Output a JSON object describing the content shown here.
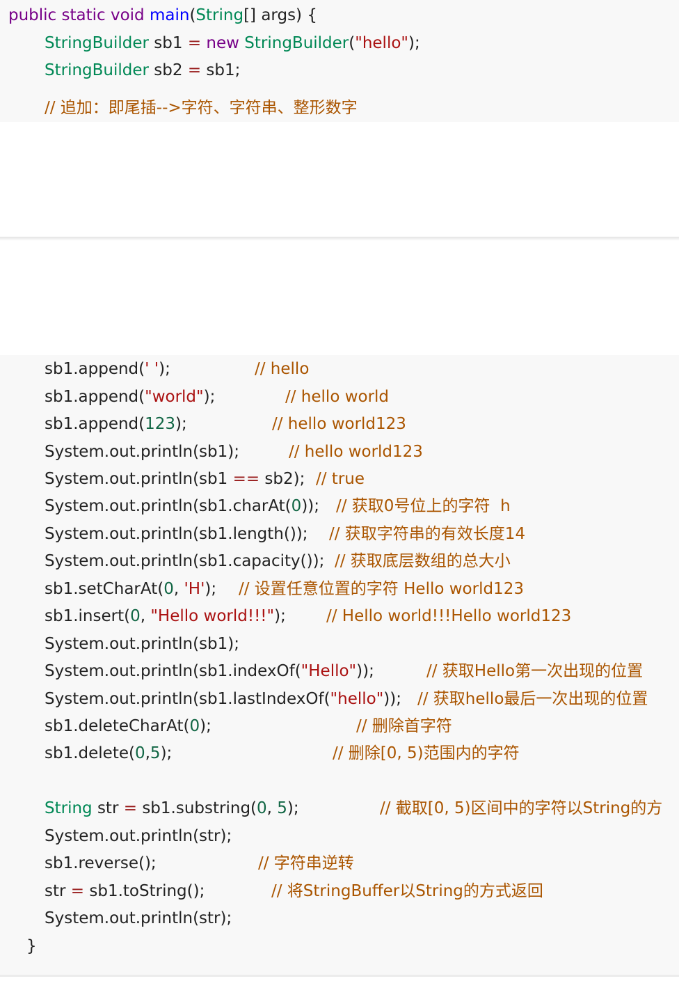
{
  "colors": {
    "keyword": "#770088",
    "type": "#008855",
    "function": "#0000ff",
    "string": "#aa1111",
    "number": "#116644",
    "operator": "#981a1a",
    "comment": "#aa5500",
    "plain": "#222222",
    "code_background": "#f8f8f8"
  },
  "top_block": {
    "lines": [
      [
        {
          "t": "public static void ",
          "k": "kw"
        },
        {
          "t": "main",
          "k": "fn"
        },
        {
          "t": "(",
          "k": "plain"
        },
        {
          "t": "String",
          "k": "type"
        },
        {
          "t": "[] args) {",
          "k": "plain"
        }
      ],
      [
        {
          "t": "StringBuilder",
          "k": "type"
        },
        {
          "t": " sb1 ",
          "k": "plain"
        },
        {
          "t": "=",
          "k": "op"
        },
        {
          "t": " ",
          "k": "plain"
        },
        {
          "t": "new",
          "k": "kw"
        },
        {
          "t": " ",
          "k": "plain"
        },
        {
          "t": "StringBuilder",
          "k": "type"
        },
        {
          "t": "(",
          "k": "plain"
        },
        {
          "t": "\"hello\"",
          "k": "str"
        },
        {
          "t": ");",
          "k": "plain"
        }
      ],
      [
        {
          "t": "StringBuilder",
          "k": "type"
        },
        {
          "t": " sb2 ",
          "k": "plain"
        },
        {
          "t": "=",
          "k": "op"
        },
        {
          "t": " sb1;",
          "k": "plain"
        }
      ],
      [
        {
          "t": "// 追加：即尾插-->字符、字符串、整形数字",
          "k": "cm"
        }
      ]
    ]
  },
  "bottom_block": {
    "lines": [
      {
        "code": [
          {
            "t": "sb1.append(",
            "k": "plain"
          },
          {
            "t": "' '",
            "k": "str"
          },
          {
            "t": ");",
            "k": "plain"
          }
        ],
        "comment": "// hello"
      },
      {
        "code": [
          {
            "t": "sb1.append(",
            "k": "plain"
          },
          {
            "t": "\"world\"",
            "k": "str"
          },
          {
            "t": ");",
            "k": "plain"
          }
        ],
        "comment": "// hello world"
      },
      {
        "code": [
          {
            "t": "sb1.append(",
            "k": "plain"
          },
          {
            "t": "123",
            "k": "num"
          },
          {
            "t": ");",
            "k": "plain"
          }
        ],
        "comment": "// hello world123"
      },
      {
        "code": [
          {
            "t": "System.out.println(sb1);",
            "k": "plain"
          }
        ],
        "comment": "// hello world123"
      },
      {
        "code": [
          {
            "t": "System.out.println(sb1 ",
            "k": "plain"
          },
          {
            "t": "==",
            "k": "op"
          },
          {
            "t": " sb2);",
            "k": "plain"
          }
        ],
        "comment": "// true"
      },
      {
        "code": [
          {
            "t": "System.out.println(sb1.charAt(",
            "k": "plain"
          },
          {
            "t": "0",
            "k": "num"
          },
          {
            "t": "));",
            "k": "plain"
          }
        ],
        "comment": "// 获取0号位上的字符  h"
      },
      {
        "code": [
          {
            "t": "System.out.println(sb1.length());",
            "k": "plain"
          }
        ],
        "comment": "// 获取字符串的有效长度14"
      },
      {
        "code": [
          {
            "t": "System.out.println(sb1.capacity());",
            "k": "plain"
          }
        ],
        "comment": "// 获取底层数组的总大小"
      },
      {
        "code": [
          {
            "t": "sb1.setCharAt(",
            "k": "plain"
          },
          {
            "t": "0",
            "k": "num"
          },
          {
            "t": ", ",
            "k": "plain"
          },
          {
            "t": "'H'",
            "k": "str"
          },
          {
            "t": ");",
            "k": "plain"
          }
        ],
        "comment": "// 设置任意位置的字符 Hello world123"
      },
      {
        "code": [
          {
            "t": "sb1.insert(",
            "k": "plain"
          },
          {
            "t": "0",
            "k": "num"
          },
          {
            "t": ", ",
            "k": "plain"
          },
          {
            "t": "\"Hello world!!!\"",
            "k": "str"
          },
          {
            "t": ");",
            "k": "plain"
          }
        ],
        "comment": "// Hello world!!!Hello world123"
      },
      {
        "code": [
          {
            "t": "System.out.println(sb1);",
            "k": "plain"
          }
        ],
        "comment": ""
      },
      {
        "code": [
          {
            "t": "System.out.println(sb1.indexOf(",
            "k": "plain"
          },
          {
            "t": "\"Hello\"",
            "k": "str"
          },
          {
            "t": "));",
            "k": "plain"
          }
        ],
        "comment": "// 获取Hello第一次出现的位置"
      },
      {
        "code": [
          {
            "t": "System.out.println(sb1.lastIndexOf(",
            "k": "plain"
          },
          {
            "t": "\"hello\"",
            "k": "str"
          },
          {
            "t": "));",
            "k": "plain"
          }
        ],
        "comment": "// 获取hello最后一次出现的位置"
      },
      {
        "code": [
          {
            "t": "sb1.deleteCharAt(",
            "k": "plain"
          },
          {
            "t": "0",
            "k": "num"
          },
          {
            "t": ");",
            "k": "plain"
          }
        ],
        "comment": "// 删除首字符"
      },
      {
        "code": [
          {
            "t": "sb1.delete(",
            "k": "plain"
          },
          {
            "t": "0",
            "k": "num"
          },
          {
            "t": ",",
            "k": "plain"
          },
          {
            "t": "5",
            "k": "num"
          },
          {
            "t": ");",
            "k": "plain"
          }
        ],
        "comment": "// 删除[0, 5)范围内的字符"
      },
      {
        "code": [],
        "comment": ""
      },
      {
        "code": [
          {
            "t": "String",
            "k": "type"
          },
          {
            "t": " str ",
            "k": "plain"
          },
          {
            "t": "=",
            "k": "op"
          },
          {
            "t": " sb1.substring(",
            "k": "plain"
          },
          {
            "t": "0",
            "k": "num"
          },
          {
            "t": ", ",
            "k": "plain"
          },
          {
            "t": "5",
            "k": "num"
          },
          {
            "t": ");",
            "k": "plain"
          }
        ],
        "comment": "// 截取[0, 5)区间中的字符以String的方"
      },
      {
        "code": [
          {
            "t": "System.out.println(str);",
            "k": "plain"
          }
        ],
        "comment": ""
      },
      {
        "code": [
          {
            "t": "sb1.reverse();",
            "k": "plain"
          }
        ],
        "comment": "// 字符串逆转"
      },
      {
        "code": [
          {
            "t": "str ",
            "k": "plain"
          },
          {
            "t": "=",
            "k": "op"
          },
          {
            "t": " sb1.toString();",
            "k": "plain"
          }
        ],
        "comment": "// 将StringBuffer以String的方式返回"
      },
      {
        "code": [
          {
            "t": "System.out.println(str);",
            "k": "plain"
          }
        ],
        "comment": ""
      },
      {
        "code": [
          {
            "t": "}",
            "k": "plain"
          }
        ],
        "comment": ""
      }
    ]
  }
}
